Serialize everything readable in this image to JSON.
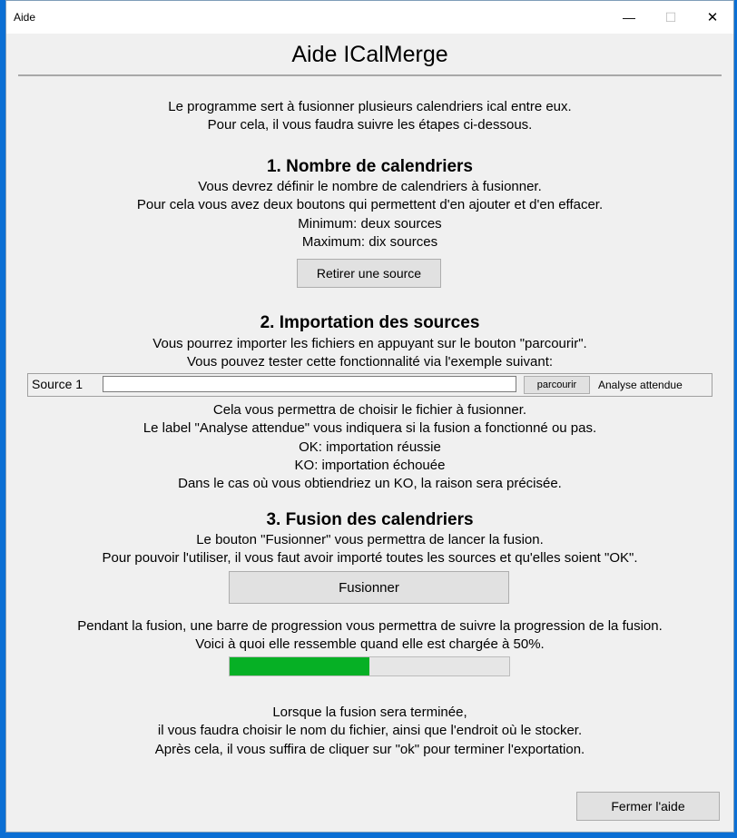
{
  "window": {
    "title": "Aide",
    "minimize_icon": "—",
    "maximize_icon": "☐",
    "close_icon": "✕"
  },
  "app_title": "Aide ICalMerge",
  "intro": {
    "lines": [
      "Le programme sert à fusionner plusieurs calendriers ical entre eux.",
      "Pour cela, il vous faudra suivre les étapes ci-dessous."
    ]
  },
  "section1": {
    "heading": "1. Nombre de calendriers",
    "lines": [
      "Vous devrez définir le nombre de calendriers à fusionner.",
      "Pour cela vous avez deux boutons qui permettent d'en ajouter et d'en effacer.",
      "Minimum: deux sources",
      "Maximum: dix sources"
    ],
    "button_label": "Retirer une source"
  },
  "section2": {
    "heading": "2. Importation des sources",
    "lines": [
      "Vous pourrez importer les fichiers en appuyant sur le bouton \"parcourir\".",
      "Vous pouvez tester cette fonctionnalité via l'exemple suivant:"
    ],
    "demo": {
      "source_label": "Source 1",
      "input_value": "",
      "browse_label": "parcourir",
      "status_label": "Analyse attendue"
    },
    "after_lines": [
      "Cela vous permettra de choisir le fichier à fusionner.",
      "Le label \"Analyse attendue\" vous indiquera si la fusion a fonctionné ou pas.",
      "OK: importation réussie",
      "KO: importation échouée",
      "Dans le cas où vous obtiendriez un KO, la raison sera précisée."
    ]
  },
  "section3": {
    "heading": "3. Fusion des calendriers",
    "lines": [
      "Le bouton \"Fusionner\" vous permettra de lancer la fusion.",
      "Pour pouvoir l'utiliser, il vous faut avoir importé toutes les sources et qu'elles soient \"OK\"."
    ],
    "button_label": "Fusionner",
    "progress_lines": [
      "Pendant la fusion, une barre de progression vous permettra de suivre la progression de la fusion.",
      "Voici à quoi elle ressemble quand elle est chargée à 50%."
    ],
    "progress_value": 0.5,
    "progress_color": "#06b025",
    "final_lines": [
      "Lorsque la fusion sera terminée,",
      "il vous faudra choisir le nom du fichier, ainsi que l'endroit où le stocker.",
      "Après cela, il vous suffira de cliquer sur \"ok\" pour terminer l'exportation."
    ]
  },
  "close_button": "Fermer l'aide"
}
